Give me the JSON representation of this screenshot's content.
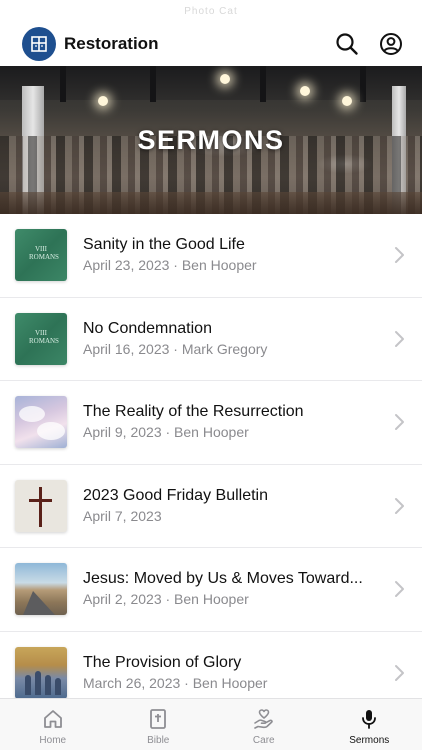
{
  "status_bar": {
    "text": "Photo Cat"
  },
  "header": {
    "title": "Restoration",
    "icons": [
      "app-logo-icon",
      "search-icon",
      "account-icon"
    ]
  },
  "hero": {
    "title": "SERMONS"
  },
  "sermons": [
    {
      "title": "Sanity in the Good Life",
      "meta": "April 23, 2023 · Ben Hooper",
      "thumb": "green-series-art",
      "thumb_text": "VIII\nROMANS"
    },
    {
      "title": "No Condemnation",
      "meta": "April 16, 2023 · Mark Gregory",
      "thumb": "green-series-art",
      "thumb_text": "VIII\nROMANS"
    },
    {
      "title": "The Reality of the Resurrection",
      "meta": "April 9, 2023 · Ben Hooper",
      "thumb": "cloud-sky-photo"
    },
    {
      "title": "2023 Good Friday Bulletin",
      "meta": "April 7, 2023",
      "thumb": "cross-image"
    },
    {
      "title": "Jesus: Moved by Us & Moves Toward...",
      "meta": "April 2, 2023 · Ben Hooper",
      "thumb": "desert-road-photo"
    },
    {
      "title": "The Provision of Glory",
      "meta": "March 26, 2023 · Ben Hooper",
      "thumb": "painting-art"
    }
  ],
  "tabs": [
    {
      "label": "Home",
      "icon": "home-icon",
      "active": false
    },
    {
      "label": "Bible",
      "icon": "bible-icon",
      "active": false
    },
    {
      "label": "Care",
      "icon": "care-hand-heart-icon",
      "active": false
    },
    {
      "label": "Sermons",
      "icon": "microphone-icon",
      "active": true
    }
  ],
  "colors": {
    "brand": "#1e4f8f",
    "text": "#111111",
    "secondary_text": "#8a8a8e",
    "tab_inactive": "#8e8e93"
  }
}
